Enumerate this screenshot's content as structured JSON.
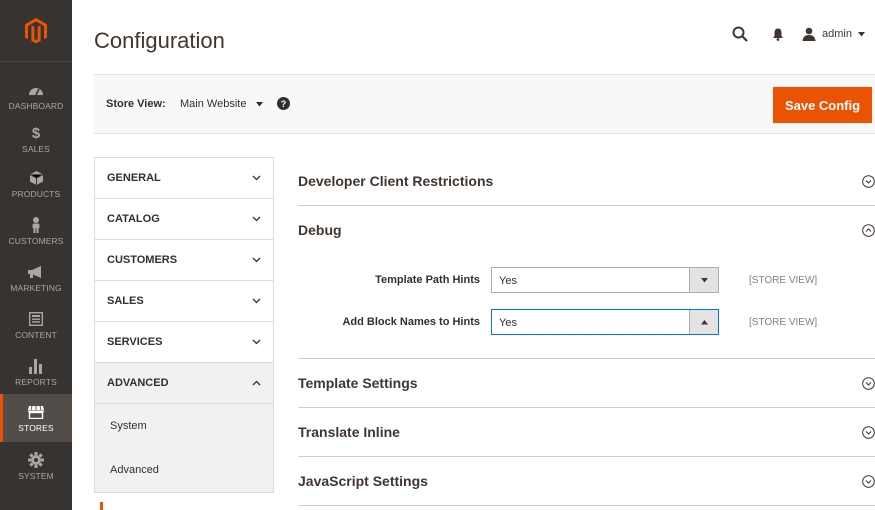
{
  "sidebar": {
    "items": [
      {
        "label": "DASHBOARD",
        "icon": "dashboard-icon"
      },
      {
        "label": "SALES",
        "icon": "dollar-icon"
      },
      {
        "label": "PRODUCTS",
        "icon": "cube-icon"
      },
      {
        "label": "CUSTOMERS",
        "icon": "person-icon"
      },
      {
        "label": "MARKETING",
        "icon": "megaphone-icon"
      },
      {
        "label": "CONTENT",
        "icon": "layout-icon"
      },
      {
        "label": "REPORTS",
        "icon": "bar-chart-icon"
      },
      {
        "label": "STORES",
        "icon": "store-icon"
      },
      {
        "label": "SYSTEM",
        "icon": "gear-icon"
      }
    ],
    "active": "STORES",
    "active_color": "#eb5202",
    "background": "#373330"
  },
  "header": {
    "title": "Configuration",
    "user": "admin"
  },
  "scope": {
    "label": "Store View:",
    "value": "Main Website",
    "help": "?"
  },
  "actions": {
    "save_label": "Save Config",
    "save_color": "#eb5202"
  },
  "tabs": [
    {
      "label": "GENERAL",
      "open": false
    },
    {
      "label": "CATALOG",
      "open": false
    },
    {
      "label": "CUSTOMERS",
      "open": false
    },
    {
      "label": "SALES",
      "open": false
    },
    {
      "label": "SERVICES",
      "open": false
    },
    {
      "label": "ADVANCED",
      "open": true
    }
  ],
  "subtabs": [
    "System",
    "Advanced"
  ],
  "sections": {
    "developer_client": {
      "title": "Developer Client Restrictions"
    },
    "debug": {
      "title": "Debug",
      "fields": [
        {
          "label": "Template Path Hints",
          "value": "Yes",
          "scope": "[STORE VIEW]"
        },
        {
          "label": "Add Block Names to Hints",
          "value": "Yes",
          "scope": "[STORE VIEW]"
        }
      ]
    },
    "template_settings": {
      "title": "Template Settings"
    },
    "translate_inline": {
      "title": "Translate Inline"
    },
    "javascript_settings": {
      "title": "JavaScript Settings"
    }
  }
}
